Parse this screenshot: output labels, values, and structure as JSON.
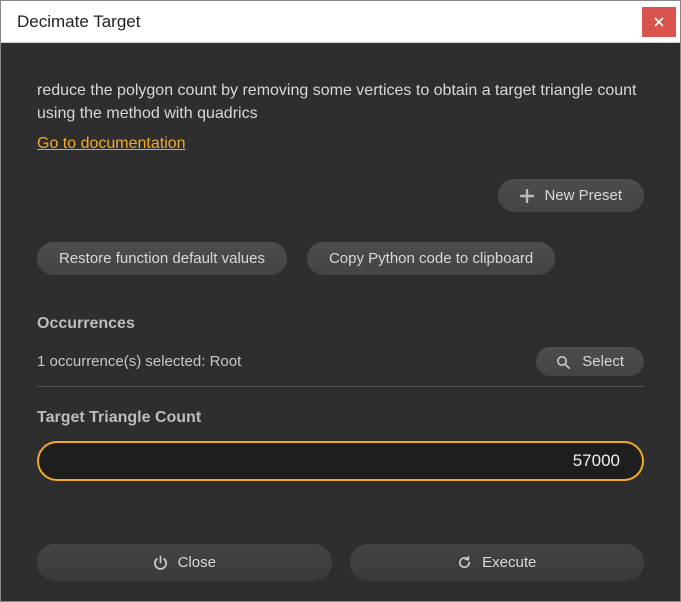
{
  "window": {
    "title": "Decimate Target"
  },
  "description": "reduce the polygon count by removing some vertices to obtain a target triangle count using the method with quadrics",
  "doc_link": "Go to documentation",
  "buttons": {
    "new_preset": "New Preset",
    "restore_defaults": "Restore function default values",
    "copy_python": "Copy Python code to clipboard",
    "select": "Select",
    "close": "Close",
    "execute": "Execute"
  },
  "sections": {
    "occurrences_label": "Occurrences",
    "occurrences_status": "1 occurrence(s) selected: Root",
    "target_label": "Target Triangle Count"
  },
  "inputs": {
    "target_triangle_count": "57000"
  },
  "colors": {
    "accent": "#f0aa28",
    "close": "#d9534f",
    "bg": "#2e2e2e"
  }
}
